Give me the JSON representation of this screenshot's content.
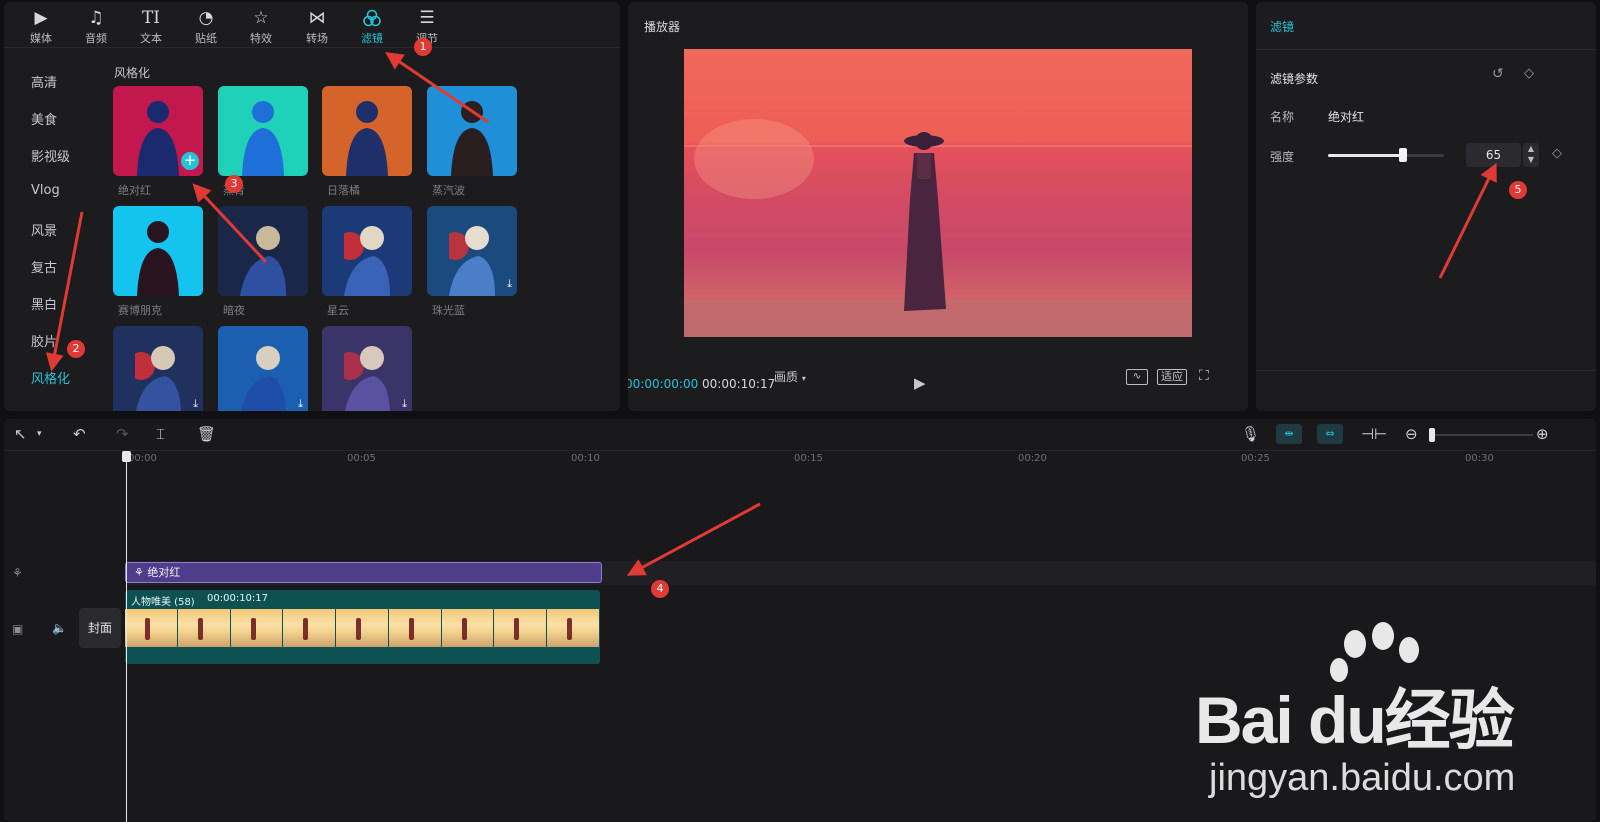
{
  "toolbar": {
    "tabs": [
      {
        "label": "媒体",
        "icon": "media-icon"
      },
      {
        "label": "音频",
        "icon": "audio-icon"
      },
      {
        "label": "文本",
        "icon": "text-icon"
      },
      {
        "label": "贴纸",
        "icon": "sticker-icon"
      },
      {
        "label": "特效",
        "icon": "effects-icon"
      },
      {
        "label": "转场",
        "icon": "transition-icon"
      },
      {
        "label": "滤镜",
        "icon": "filter-icon"
      },
      {
        "label": "调节",
        "icon": "adjust-icon"
      }
    ],
    "active_tab": "滤镜"
  },
  "categories": [
    "高清",
    "美食",
    "影视级",
    "Vlog",
    "风景",
    "复古",
    "黑白",
    "胶片",
    "风格化"
  ],
  "active_category": "风格化",
  "section_title": "风格化",
  "filters": [
    {
      "label": "绝对红"
    },
    {
      "label": "蒸青"
    },
    {
      "label": "日落橘"
    },
    {
      "label": "蒸汽波"
    },
    {
      "label": "赛博朋克"
    },
    {
      "label": "暗夜"
    },
    {
      "label": "星云"
    },
    {
      "label": "珠光蓝"
    }
  ],
  "player": {
    "title": "播放器",
    "current_time": "00:00:00:00",
    "total_time": "00:00:10:17",
    "quality_label": "画质",
    "fit_label": "适应"
  },
  "inspector": {
    "tab": "滤镜",
    "section": "滤镜参数",
    "name_label": "名称",
    "name_value": "绝对红",
    "strength_label": "强度",
    "strength_value": "65",
    "strength_fraction": 0.65
  },
  "timeline": {
    "ruler": [
      "00:00",
      "00:05",
      "00:10",
      "00:15",
      "00:20",
      "00:25",
      "00:30"
    ],
    "filter_clip_label": "绝对红",
    "video_clip_name": "人物唯美 (58)",
    "video_clip_duration": "00:00:10:17",
    "cover_label": "封面"
  },
  "annotations": [
    "1",
    "2",
    "3",
    "4",
    "5"
  ],
  "watermark": {
    "brand": "Bai du经验",
    "url": "jingyan.baidu.com"
  },
  "colors": {
    "accent": "#27c2d6",
    "annotation": "#e03a34",
    "filter_clip": "#4d3d8a",
    "video_clip": "#0e5153"
  }
}
